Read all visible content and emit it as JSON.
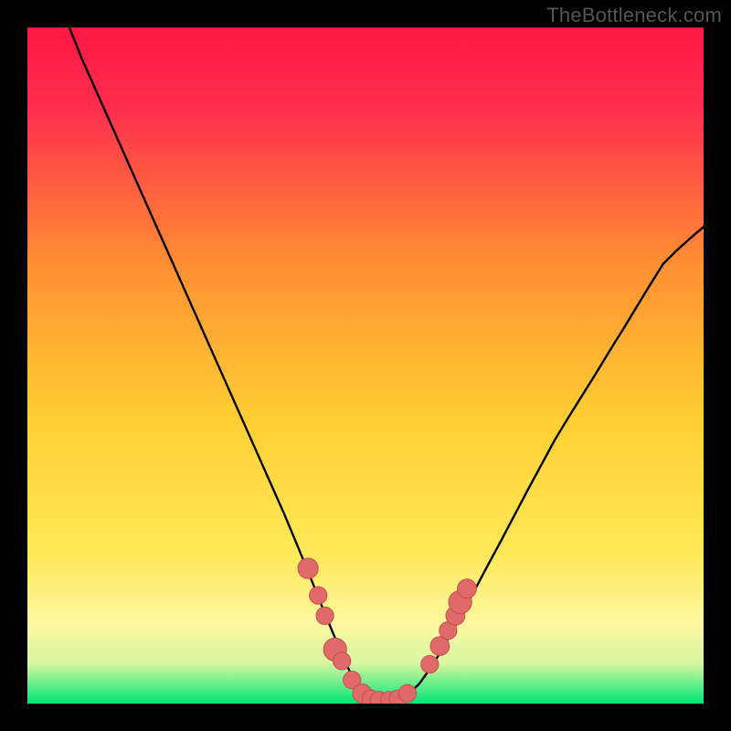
{
  "watermark": {
    "text": "TheBottleneck.com"
  },
  "colors": {
    "black": "#000000",
    "curve": "#000000",
    "dot_fill": "#e06a6a",
    "dot_stroke": "#c94d4d",
    "grad_top": "#ff1744",
    "grad_mid1": "#ff9933",
    "grad_mid2": "#ffe44d",
    "grad_mid3": "#fff99e",
    "grad_bottom": "#00e676"
  },
  "chart_data": {
    "type": "line",
    "description": "V-shaped bottleneck curve over a vertical red→orange→yellow→green gradient. The curve is a single black line that starts at the top-left, descends steeply to a near-flat trough around x≈0.50–0.55, then rises to the right. A cluster of coral dots sits along the trough and lower walls.",
    "x": [
      0.062,
      0.08,
      0.1,
      0.12,
      0.14,
      0.16,
      0.18,
      0.2,
      0.22,
      0.24,
      0.26,
      0.28,
      0.3,
      0.32,
      0.34,
      0.36,
      0.38,
      0.4,
      0.42,
      0.44,
      0.46,
      0.48,
      0.5,
      0.52,
      0.54,
      0.56,
      0.58,
      0.6,
      0.62,
      0.64,
      0.66,
      0.68,
      0.7,
      0.72,
      0.74,
      0.76,
      0.78,
      0.8,
      0.82,
      0.84,
      0.86,
      0.88,
      0.9,
      0.92,
      0.94,
      0.96,
      0.98,
      1.0
    ],
    "values": [
      1.0,
      0.955,
      0.91,
      0.865,
      0.82,
      0.775,
      0.73,
      0.685,
      0.64,
      0.595,
      0.55,
      0.505,
      0.46,
      0.415,
      0.37,
      0.325,
      0.28,
      0.232,
      0.183,
      0.133,
      0.085,
      0.04,
      0.01,
      0.003,
      0.003,
      0.01,
      0.03,
      0.058,
      0.092,
      0.128,
      0.165,
      0.203,
      0.24,
      0.278,
      0.316,
      0.353,
      0.39,
      0.423,
      0.455,
      0.487,
      0.52,
      0.552,
      0.585,
      0.618,
      0.65,
      0.67,
      0.688,
      0.705
    ],
    "xlim": [
      0,
      1
    ],
    "ylim": [
      0,
      1
    ],
    "xlabel": "",
    "ylabel": "",
    "title": "",
    "dots": [
      {
        "x": 0.415,
        "y": 0.2,
        "r": 0.015
      },
      {
        "x": 0.43,
        "y": 0.16,
        "r": 0.013
      },
      {
        "x": 0.44,
        "y": 0.13,
        "r": 0.013
      },
      {
        "x": 0.455,
        "y": 0.08,
        "r": 0.017
      },
      {
        "x": 0.465,
        "y": 0.063,
        "r": 0.013
      },
      {
        "x": 0.48,
        "y": 0.035,
        "r": 0.013
      },
      {
        "x": 0.495,
        "y": 0.015,
        "r": 0.014
      },
      {
        "x": 0.508,
        "y": 0.007,
        "r": 0.013
      },
      {
        "x": 0.52,
        "y": 0.005,
        "r": 0.013
      },
      {
        "x": 0.535,
        "y": 0.005,
        "r": 0.013
      },
      {
        "x": 0.548,
        "y": 0.007,
        "r": 0.013
      },
      {
        "x": 0.562,
        "y": 0.015,
        "r": 0.013
      },
      {
        "x": 0.595,
        "y": 0.058,
        "r": 0.013
      },
      {
        "x": 0.61,
        "y": 0.085,
        "r": 0.014
      },
      {
        "x": 0.622,
        "y": 0.108,
        "r": 0.013
      },
      {
        "x": 0.633,
        "y": 0.13,
        "r": 0.014
      },
      {
        "x": 0.64,
        "y": 0.15,
        "r": 0.017
      },
      {
        "x": 0.65,
        "y": 0.17,
        "r": 0.014
      }
    ]
  }
}
